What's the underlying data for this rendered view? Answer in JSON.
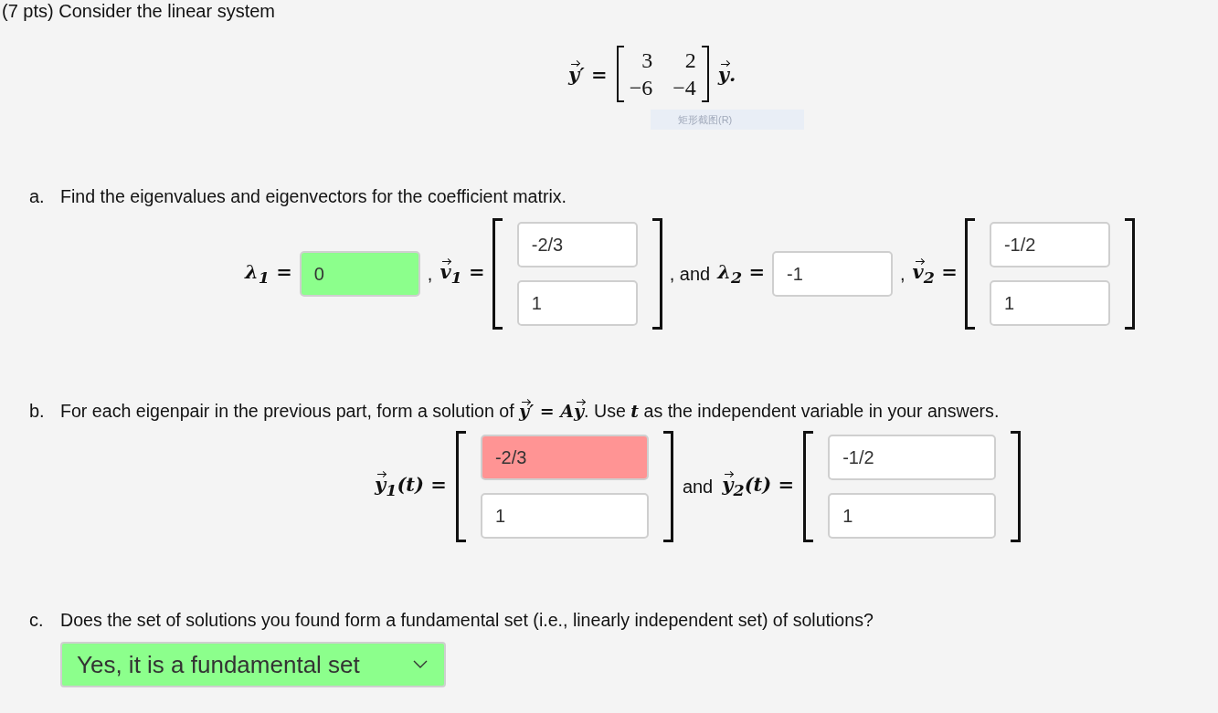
{
  "header": {
    "text": "(7 pts) Consider the linear system"
  },
  "equation": {
    "lhs": [
      {
        "kind": "vec",
        "text": "y"
      },
      {
        "kind": "plain",
        "text": "′ ="
      }
    ],
    "matrix": [
      [
        "3",
        "2"
      ],
      [
        "−6",
        "−4"
      ]
    ],
    "rhs": [
      {
        "kind": "vec",
        "text": "y"
      },
      {
        "kind": "plain",
        "text": "."
      }
    ]
  },
  "tooltip": {
    "text": "矩形截图(R)"
  },
  "parts": [
    {
      "marker": "a.",
      "question": [
        {
          "kind": "text",
          "text": "Find the eigenvalues and eigenvectors for the coefficient matrix."
        }
      ],
      "row": [
        {
          "kind": "math",
          "tokens": [
            {
              "kind": "plain",
              "text": "λ$_{1}$ ="
            }
          ]
        },
        {
          "kind": "field",
          "value": "0",
          "correct": true
        },
        {
          "kind": "text",
          "text": ","
        },
        {
          "kind": "math",
          "tokens": [
            {
              "kind": "vec",
              "text": "v"
            },
            {
              "kind": "plain",
              "text": "$_{1}$ ="
            }
          ]
        },
        {
          "kind": "vector",
          "fields": [
            {
              "value": "-2/3"
            },
            {
              "value": "1"
            }
          ]
        },
        {
          "kind": "text",
          "text": ", and"
        },
        {
          "kind": "math",
          "tokens": [
            {
              "kind": "plain",
              "text": "λ$_{2}$ ="
            }
          ]
        },
        {
          "kind": "field",
          "value": "-1"
        },
        {
          "kind": "text",
          "text": ","
        },
        {
          "kind": "math",
          "tokens": [
            {
              "kind": "vec",
              "text": "v"
            },
            {
              "kind": "plain",
              "text": "$_{2}$ ="
            }
          ]
        },
        {
          "kind": "vector",
          "fields": [
            {
              "value": "-1/2"
            },
            {
              "value": "1"
            }
          ]
        }
      ]
    },
    {
      "marker": "b.",
      "question": [
        {
          "kind": "text",
          "text": "For each eigenpair in the previous part, form a solution of "
        },
        {
          "kind": "math",
          "tokens": [
            {
              "kind": "vec",
              "text": "y"
            },
            {
              "kind": "plain",
              "text": "′ = A"
            },
            {
              "kind": "vec",
              "text": "y"
            }
          ]
        },
        {
          "kind": "text",
          "text": ". Use "
        },
        {
          "kind": "math",
          "tokens": [
            {
              "kind": "plain",
              "text": "t"
            }
          ]
        },
        {
          "kind": "text",
          "text": " as the independent variable in your answers."
        }
      ],
      "row": [
        {
          "kind": "math",
          "tokens": [
            {
              "kind": "vec",
              "text": "y"
            },
            {
              "kind": "plain",
              "text": "$_{1}$(t) ="
            }
          ]
        },
        {
          "kind": "vector",
          "fields": [
            {
              "value": "-2/3",
              "correct": false
            },
            {
              "value": "1"
            }
          ]
        },
        {
          "kind": "text",
          "text": "and"
        },
        {
          "kind": "math",
          "tokens": [
            {
              "kind": "vec",
              "text": "y"
            },
            {
              "kind": "plain",
              "text": "$_{2}$(t) ="
            }
          ]
        },
        {
          "kind": "vector",
          "fields": [
            {
              "value": "-1/2"
            },
            {
              "value": "1"
            }
          ]
        }
      ]
    },
    {
      "marker": "c.",
      "question": [
        {
          "kind": "text",
          "text": "Does the set of solutions you found form a fundamental set (i.e., linearly independent set) of solutions?"
        }
      ],
      "row": [
        {
          "kind": "dropdown",
          "value": "Yes, it is a fundamental set",
          "correct": true
        }
      ]
    }
  ]
}
